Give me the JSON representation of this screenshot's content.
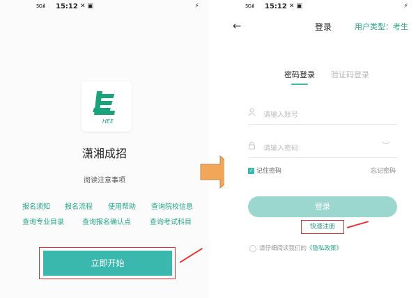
{
  "status_bar": {
    "signal": "5G ıll",
    "time": "15:12",
    "icons": "✕ ▣",
    "right_icon": "⚡"
  },
  "left_screen": {
    "logo_text": "HEE",
    "app_name": "潇湘成招",
    "notice_title": "阅读注意事项",
    "notice_links": [
      "报名须知",
      "报名流程",
      "使用帮助",
      "查询院校信息",
      "查询专业目录",
      "查询报名确认点",
      "查询考试科目"
    ],
    "start_button": "立即开始"
  },
  "right_screen": {
    "back_icon": "←",
    "title": "登录",
    "user_type": "用户类型：考生",
    "tabs": [
      "密码登录",
      "验证码登录"
    ],
    "account_placeholder": "请输入账号",
    "password_placeholder": "请输入密码",
    "remember_label": "记住密码",
    "forgot_label": "忘记密码",
    "login_button": "登录",
    "register_link": "快速注册",
    "agreement_prefix": "请仔细阅读我们的",
    "agreement_link": "《隐私政策》"
  },
  "colors": {
    "accent": "#3bb8ad",
    "highlight": "#e53333",
    "arrow": "#f2a65a"
  }
}
